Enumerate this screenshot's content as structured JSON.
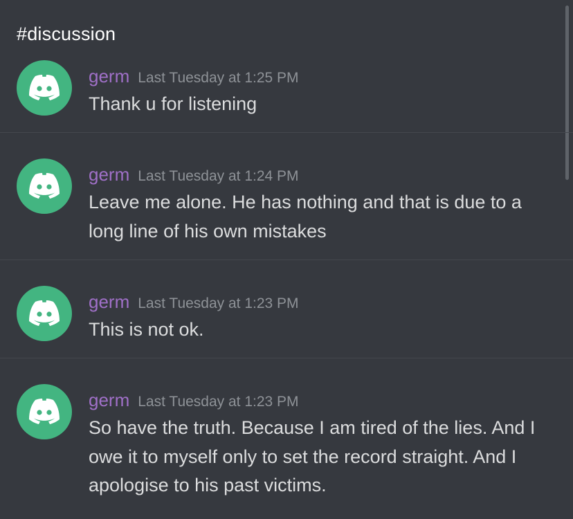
{
  "channel": {
    "title": "#discussion"
  },
  "colors": {
    "background": "#36393f",
    "avatar_bg": "#43b581",
    "username": "#a070c8",
    "timestamp": "#8e9297",
    "message_text": "#dcddde"
  },
  "messages": [
    {
      "avatar_icon": "discord-logo-icon",
      "username": "germ",
      "timestamp": "Last Tuesday at 1:25 PM",
      "text": "Thank u for listening"
    },
    {
      "avatar_icon": "discord-logo-icon",
      "username": "germ",
      "timestamp": "Last Tuesday at 1:24 PM",
      "text": "Leave me alone. He has nothing and that is due to a long line of his own mistakes"
    },
    {
      "avatar_icon": "discord-logo-icon",
      "username": "germ",
      "timestamp": "Last Tuesday at 1:23 PM",
      "text": "This is not ok."
    },
    {
      "avatar_icon": "discord-logo-icon",
      "username": "germ",
      "timestamp": "Last Tuesday at 1:23 PM",
      "text": "So have the truth. Because I am tired of the lies. And I owe it to myself only to set the record straight. And I apologise to his past victims."
    }
  ]
}
